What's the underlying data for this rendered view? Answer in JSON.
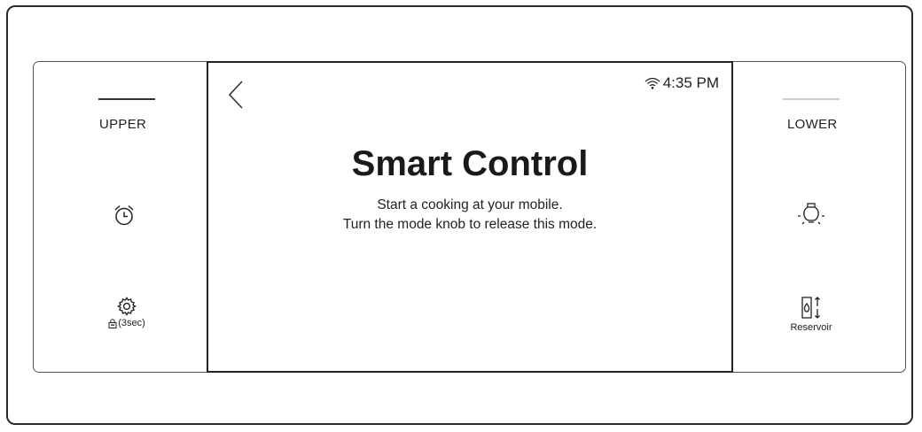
{
  "left_panel": {
    "upper_label": "UPPER",
    "timer_icon": "alarm-clock-icon",
    "settings_icon": "gear-icon",
    "lock_label": "ὑ2(3sec)",
    "lock_label_text": "(3sec)"
  },
  "screen": {
    "back_icon": "chevron-left-icon",
    "wifi_icon": "wifi-icon",
    "time": "4:35 PM",
    "title": "Smart Control",
    "line1": "Start a cooking at your mobile.",
    "line2": "Turn the mode knob to release this mode."
  },
  "right_panel": {
    "lower_label": "LOWER",
    "light_icon": "light-bulb-icon",
    "reservoir_icon": "water-reservoir-icon",
    "reservoir_label": "Reservoir"
  },
  "colors": {
    "upper_bar": "#333333",
    "lower_bar": "#cccccc"
  }
}
